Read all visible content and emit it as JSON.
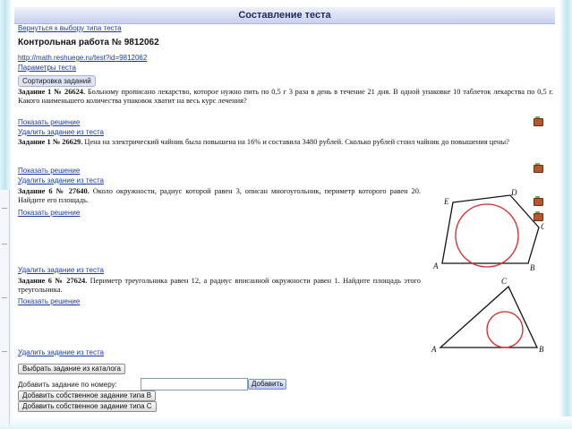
{
  "title": "Составление теста",
  "links": {
    "back": "Вернуться к выбору типа теста",
    "url": "http://math.reshuege.ru/test?id=9812062",
    "params": "Параметры теста"
  },
  "heading": "Контрольная работа № 9812062",
  "sort_button": "Сортировка заданий",
  "tasks": [
    {
      "label": "Задание 1 № 26624.",
      "text": "Больному прописано лекарство, которое нужно пить по 0,5 г 3 раза в день в течение 21 дня. В одной упаковке 10 таблеток лекарства по 0,5 г. Какого наименьшего количества упаковок хватит на весь курс лечения?",
      "show": "Показать решение",
      "remove": "Удалить задание из теста"
    },
    {
      "label": "Задание 1 № 26629.",
      "text": "Цена на электрический чайник была повышена на 16% и составила 3480 рублей. Сколько рублей стоил чайник до повышения цены?",
      "show": "Показать решение",
      "remove": "Удалить задание из теста"
    },
    {
      "label": "Задание 6 № 27640.",
      "text": "Около окружности, радиус которой равен 3, описан многоугольник, периметр которого равен 20. Найдите его площадь.",
      "show": "Показать решение",
      "remove": "Удалить задание из теста",
      "figure_labels": [
        "E",
        "D",
        "C",
        "B",
        "A"
      ]
    },
    {
      "label": "Задание 6 № 27624.",
      "text": "Периметр треугольника равен 12, а радиус вписанной окружности равен 1. Найдите площадь этого треугольника.",
      "show": "Показать решение",
      "remove": "Удалить задание из теста",
      "figure_labels": [
        "C",
        "A",
        "B"
      ]
    }
  ],
  "catalog_button": "Выбрать задание из каталога",
  "add_by_number_label": "Добавить задание по номеру:",
  "add_by_number_value": "",
  "add_button": "Добавить",
  "add_own_b": "Добавить собственное задание типа B",
  "add_own_c": "Добавить собственное задание типа C",
  "colors": {
    "accent": "#1d2a66",
    "circle": "#d8262b",
    "link": "#1a3aa8"
  }
}
